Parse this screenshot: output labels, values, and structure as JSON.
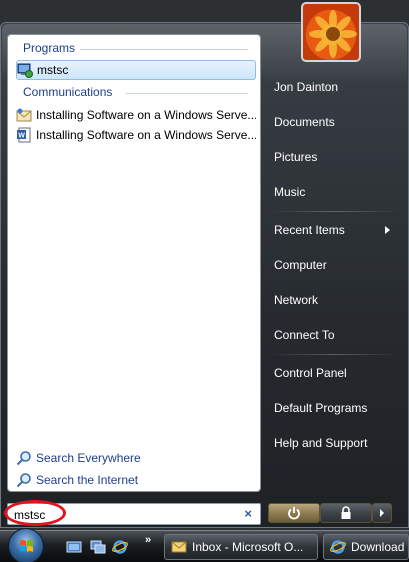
{
  "left_panel": {
    "programs_title": "Programs",
    "programs": [
      {
        "label": "mstsc",
        "icon": "remote-desktop-icon"
      }
    ],
    "communications_title": "Communications",
    "communications": [
      {
        "label": "Installing Software on a Windows Serve...",
        "icon": "envelope-icon"
      },
      {
        "label": "Installing Software on a Windows Serve...",
        "icon": "word-document-icon"
      }
    ],
    "search_everywhere": "Search Everywhere",
    "search_internet": "Search the Internet"
  },
  "search": {
    "value": "mstsc",
    "clear_icon": "×"
  },
  "right_panel": {
    "user_name": "Jon Dainton",
    "items": [
      "Documents",
      "Pictures",
      "Music",
      "Recent Items",
      "Computer",
      "Network",
      "Connect To",
      "Control Panel",
      "Default Programs",
      "Help and Support"
    ]
  },
  "taskbar": {
    "quick_launch_more": "»",
    "buttons": [
      {
        "label": "Inbox - Microsoft O...",
        "icon": "outlook-icon"
      },
      {
        "label": "Download t",
        "icon": "internet-explorer-icon"
      }
    ]
  },
  "colors": {
    "highlight_ellipse": "#e0141e",
    "link_blue": "#1e3f8c"
  }
}
